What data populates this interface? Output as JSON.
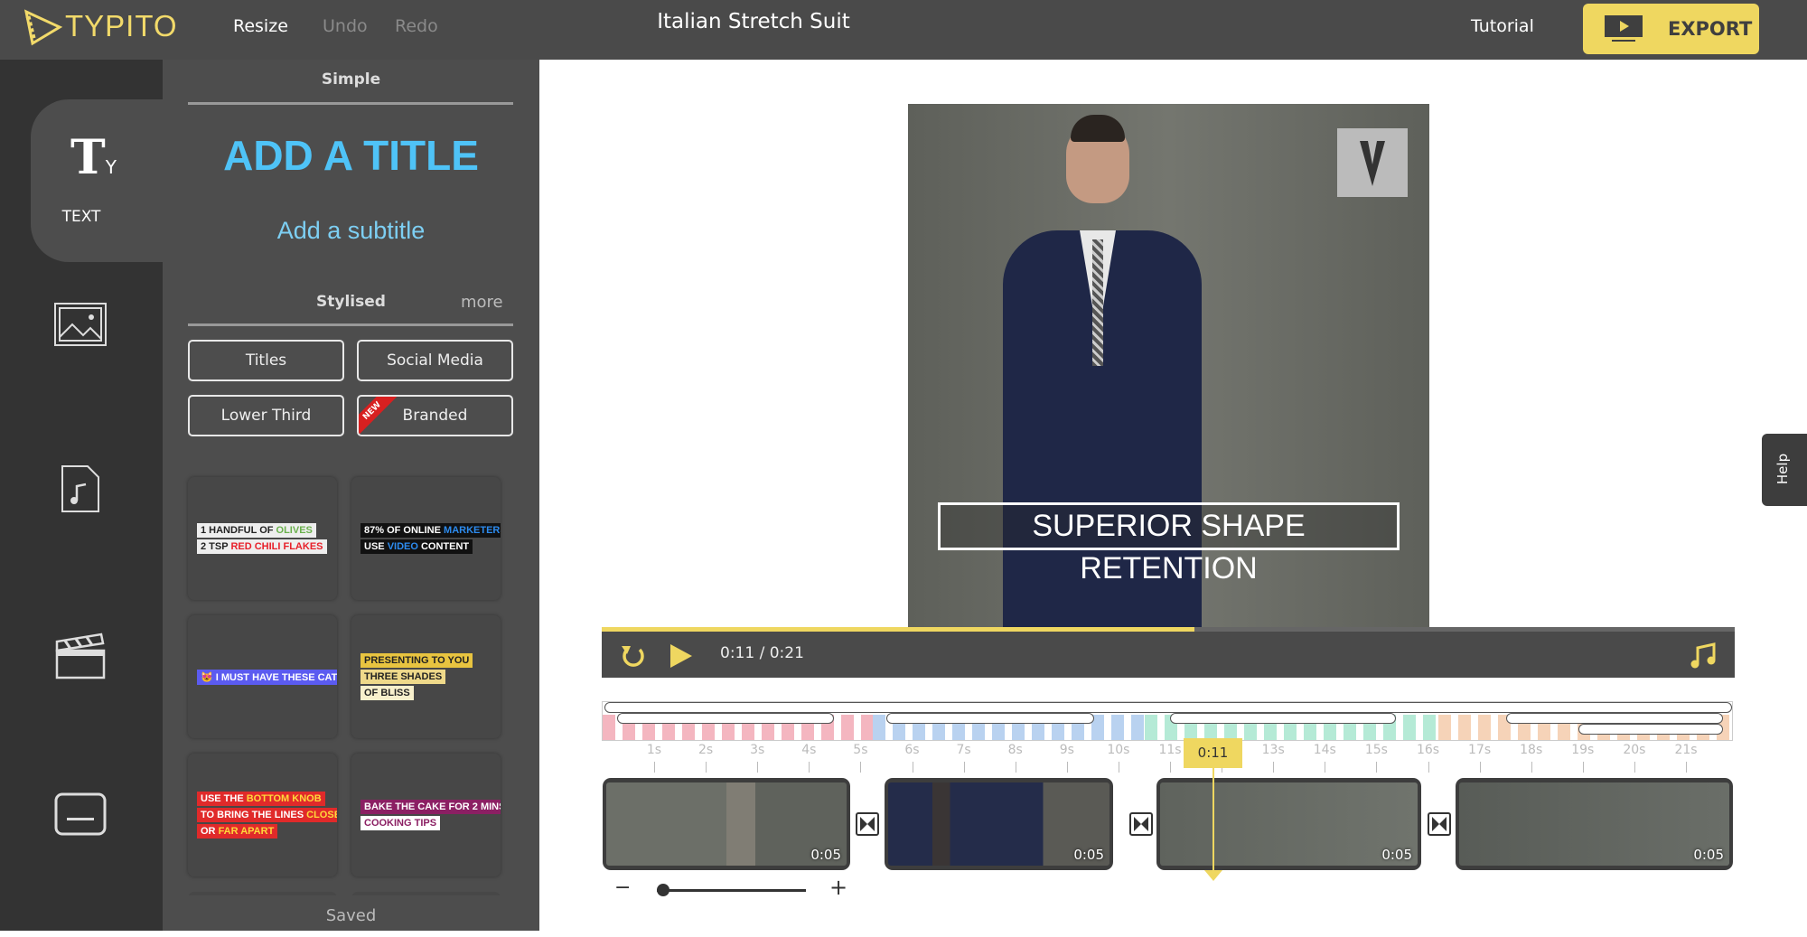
{
  "header": {
    "logo": "TYPITO",
    "resize": "Resize",
    "undo": "Undo",
    "redo": "Redo",
    "project_title": "Italian Stretch Suit",
    "tutorial": "Tutorial",
    "export": "EXPORT"
  },
  "rail": {
    "active_label": "TEXT",
    "items": [
      "text-icon",
      "image-icon",
      "audio-file-icon",
      "clapperboard-icon",
      "caption-icon"
    ]
  },
  "panel": {
    "simple_heading": "Simple",
    "add_title": "ADD A TITLE",
    "add_subtitle": "Add a subtitle",
    "stylised_heading": "Stylised",
    "more": "more",
    "categories": [
      "Titles",
      "Social Media",
      "Lower Third",
      "Branded"
    ],
    "new_badge": "NEW",
    "cards": [
      {
        "bg": "#eee",
        "lines": [
          [
            [
              "1 HANDFUL OF ",
              "#222"
            ],
            [
              "OLIVES",
              "#6ab04c"
            ]
          ],
          [
            [
              "2 TSP ",
              "#222"
            ],
            [
              "RED CHILI FLAKES",
              "#e8202a"
            ]
          ]
        ]
      },
      {
        "bg": "#111",
        "lines": [
          [
            [
              "87% OF ONLINE ",
              "#fff"
            ],
            [
              "MARKETERS",
              "#2d8cf0"
            ]
          ],
          [
            [
              "USE ",
              "#fff"
            ],
            [
              "VIDEO",
              "#2d8cf0"
            ],
            [
              " CONTENT",
              "#fff"
            ]
          ]
        ]
      },
      {
        "bg": "#5b5bf0",
        "lines": [
          [
            [
              "😻 I MUST HAVE THESE CAT BUTT COSTERS! 😻",
              "#fff"
            ]
          ]
        ]
      },
      {
        "bg": "#e8c440",
        "lines": [
          [
            [
              "PRESENTING TO YOU",
              "#222"
            ]
          ],
          [
            [
              "THREE SHADES",
              "#222"
            ]
          ],
          [
            [
              "OF BLISS",
              "#222"
            ]
          ]
        ]
      },
      {
        "bg": "#e02a2a",
        "lines": [
          [
            [
              "USE THE ",
              "#fff"
            ],
            [
              "BOTTOM KNOB",
              "#ffd83a"
            ]
          ],
          [
            [
              "TO BRING THE LINES ",
              "#fff"
            ],
            [
              "CLOSER",
              "#ffd83a"
            ]
          ],
          [
            [
              "OR ",
              "#fff"
            ],
            [
              "FAR APART",
              "#ffd83a"
            ]
          ]
        ]
      },
      {
        "bg": "#8b1f63",
        "lines": [
          [
            [
              "BAKE THE CAKE FOR 2 MINS",
              "#fff"
            ]
          ],
          [
            [
              "COOKING TIPS",
              "#8b1f63"
            ]
          ]
        ]
      }
    ],
    "saved": "Saved"
  },
  "preview": {
    "caption": "SUPERIOR SHAPE RETENTION",
    "help": "Help"
  },
  "player": {
    "current": "0:11",
    "separator": "/",
    "total": "0:21",
    "progress_percent": 52.3
  },
  "timeline": {
    "playhead": "0:11",
    "ticks": [
      "1s",
      "2s",
      "3s",
      "4s",
      "5s",
      "6s",
      "7s",
      "8s",
      "9s",
      "10s",
      "11s",
      "12s",
      "13s",
      "14s",
      "15s",
      "16s",
      "17s",
      "18s",
      "19s",
      "20s",
      "21s"
    ],
    "clips": [
      {
        "duration": "0:05"
      },
      {
        "duration": "0:05"
      },
      {
        "duration": "0:05"
      },
      {
        "duration": "0:05"
      }
    ],
    "zoom_minus": "−",
    "zoom_plus": "+",
    "zoom_level": 0
  },
  "colors": {
    "accent": "#efd760",
    "title_blue": "#4fc3f7",
    "segments": [
      "#f4b6c0",
      "#b9d2f0",
      "#b5ead6",
      "#f6d3b8"
    ]
  }
}
